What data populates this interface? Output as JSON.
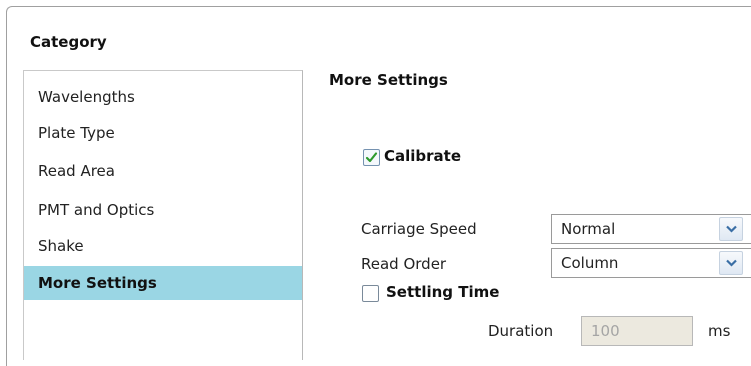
{
  "category": {
    "title": "Category",
    "items": [
      {
        "label": "Wavelengths"
      },
      {
        "label": "Plate Type"
      },
      {
        "label": "Read Area"
      },
      {
        "label": "PMT and Optics"
      },
      {
        "label": "Shake"
      },
      {
        "label": "More Settings",
        "selected": true
      }
    ]
  },
  "panel": {
    "title": "More Settings",
    "calibrate": {
      "label": "Calibrate",
      "checked": true
    },
    "carriage_speed": {
      "label": "Carriage Speed",
      "value": "Normal"
    },
    "read_order": {
      "label": "Read Order",
      "value": "Column"
    },
    "settling_time": {
      "label": "Settling Time",
      "checked": false
    },
    "duration": {
      "label": "Duration",
      "value": "100",
      "unit": "ms",
      "disabled": true
    }
  },
  "colors": {
    "selection": "#9ad6e4",
    "check_mark": "#2e9a2e",
    "disabled_field": "#ece9df"
  }
}
